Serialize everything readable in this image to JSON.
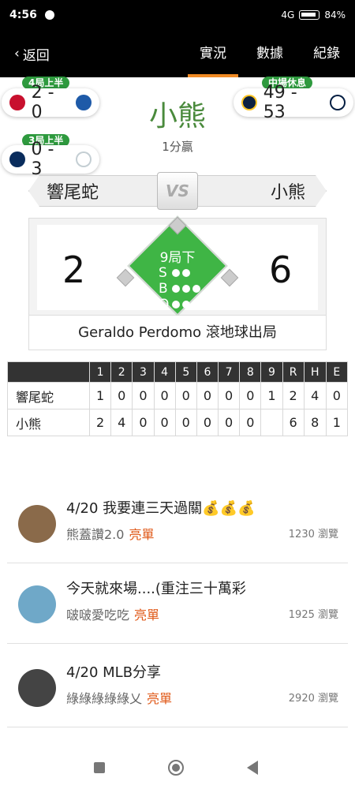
{
  "status": {
    "time": "4:56",
    "battery": "84%",
    "signal": "4G"
  },
  "nav": {
    "back_label": "返回",
    "tabs": [
      {
        "label": "實況",
        "active": true
      },
      {
        "label": "數據",
        "active": false
      },
      {
        "label": "紀錄",
        "active": false
      }
    ]
  },
  "other_games": [
    {
      "tag": "4局上半",
      "score": "2 - 0"
    },
    {
      "tag": "中場休息",
      "score": "49 - 53"
    },
    {
      "tag": "3局上半",
      "score": "0 - 3"
    }
  ],
  "result": {
    "winner": "小熊",
    "subtitle": "1分贏"
  },
  "matchup": {
    "away": "響尾蛇",
    "home": "小熊",
    "vs": "VS"
  },
  "scoreboard": {
    "away_score": "2",
    "home_score": "6",
    "inning": "9局下",
    "sbo": [
      "S",
      "B",
      "O"
    ],
    "last_play": "Geraldo Perdomo 滾地球出局"
  },
  "linescore": {
    "headers": [
      "",
      "1",
      "2",
      "3",
      "4",
      "5",
      "6",
      "7",
      "8",
      "9",
      "R",
      "H",
      "E"
    ],
    "rows": [
      {
        "team": "響尾蛇",
        "cells": [
          "1",
          "0",
          "0",
          "0",
          "0",
          "0",
          "0",
          "0",
          "1",
          "2",
          "4",
          "0"
        ]
      },
      {
        "team": "小熊",
        "cells": [
          "2",
          "4",
          "0",
          "0",
          "0",
          "0",
          "0",
          "0",
          "",
          "6",
          "8",
          "1"
        ]
      }
    ]
  },
  "posts": [
    {
      "title": "4/20 我要連三天過關💰💰💰",
      "author": "熊蓋讚2.0",
      "tag": "亮單",
      "views": "1230 瀏覽",
      "avatar_color": "#8a6a4a"
    },
    {
      "title": "今天就來場....(重注三十萬彩",
      "author": "啵啵愛吃吃",
      "tag": "亮單",
      "views": "1925 瀏覽",
      "avatar_color": "#6fa8c8"
    },
    {
      "title": "4/20 MLB分享",
      "author": "綠綠綠綠綠乂",
      "tag": "亮單",
      "views": "2920 瀏覽",
      "avatar_color": "#444444"
    }
  ]
}
